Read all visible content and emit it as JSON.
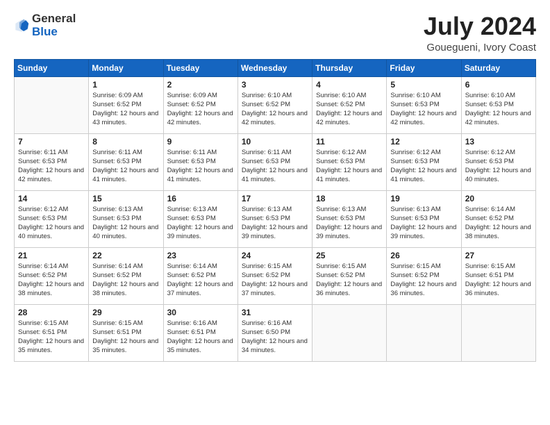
{
  "logo": {
    "text_general": "General",
    "text_blue": "Blue",
    "icon_title": "General Blue Logo"
  },
  "header": {
    "month": "July 2024",
    "location": "Gouegueni, Ivory Coast"
  },
  "weekdays": [
    "Sunday",
    "Monday",
    "Tuesday",
    "Wednesday",
    "Thursday",
    "Friday",
    "Saturday"
  ],
  "weeks": [
    [
      {
        "day": "",
        "sunrise": "",
        "sunset": "",
        "daylight": ""
      },
      {
        "day": "1",
        "sunrise": "Sunrise: 6:09 AM",
        "sunset": "Sunset: 6:52 PM",
        "daylight": "Daylight: 12 hours and 43 minutes."
      },
      {
        "day": "2",
        "sunrise": "Sunrise: 6:09 AM",
        "sunset": "Sunset: 6:52 PM",
        "daylight": "Daylight: 12 hours and 42 minutes."
      },
      {
        "day": "3",
        "sunrise": "Sunrise: 6:10 AM",
        "sunset": "Sunset: 6:52 PM",
        "daylight": "Daylight: 12 hours and 42 minutes."
      },
      {
        "day": "4",
        "sunrise": "Sunrise: 6:10 AM",
        "sunset": "Sunset: 6:52 PM",
        "daylight": "Daylight: 12 hours and 42 minutes."
      },
      {
        "day": "5",
        "sunrise": "Sunrise: 6:10 AM",
        "sunset": "Sunset: 6:53 PM",
        "daylight": "Daylight: 12 hours and 42 minutes."
      },
      {
        "day": "6",
        "sunrise": "Sunrise: 6:10 AM",
        "sunset": "Sunset: 6:53 PM",
        "daylight": "Daylight: 12 hours and 42 minutes."
      }
    ],
    [
      {
        "day": "7",
        "sunrise": "Sunrise: 6:11 AM",
        "sunset": "Sunset: 6:53 PM",
        "daylight": "Daylight: 12 hours and 42 minutes."
      },
      {
        "day": "8",
        "sunrise": "Sunrise: 6:11 AM",
        "sunset": "Sunset: 6:53 PM",
        "daylight": "Daylight: 12 hours and 41 minutes."
      },
      {
        "day": "9",
        "sunrise": "Sunrise: 6:11 AM",
        "sunset": "Sunset: 6:53 PM",
        "daylight": "Daylight: 12 hours and 41 minutes."
      },
      {
        "day": "10",
        "sunrise": "Sunrise: 6:11 AM",
        "sunset": "Sunset: 6:53 PM",
        "daylight": "Daylight: 12 hours and 41 minutes."
      },
      {
        "day": "11",
        "sunrise": "Sunrise: 6:12 AM",
        "sunset": "Sunset: 6:53 PM",
        "daylight": "Daylight: 12 hours and 41 minutes."
      },
      {
        "day": "12",
        "sunrise": "Sunrise: 6:12 AM",
        "sunset": "Sunset: 6:53 PM",
        "daylight": "Daylight: 12 hours and 41 minutes."
      },
      {
        "day": "13",
        "sunrise": "Sunrise: 6:12 AM",
        "sunset": "Sunset: 6:53 PM",
        "daylight": "Daylight: 12 hours and 40 minutes."
      }
    ],
    [
      {
        "day": "14",
        "sunrise": "Sunrise: 6:12 AM",
        "sunset": "Sunset: 6:53 PM",
        "daylight": "Daylight: 12 hours and 40 minutes."
      },
      {
        "day": "15",
        "sunrise": "Sunrise: 6:13 AM",
        "sunset": "Sunset: 6:53 PM",
        "daylight": "Daylight: 12 hours and 40 minutes."
      },
      {
        "day": "16",
        "sunrise": "Sunrise: 6:13 AM",
        "sunset": "Sunset: 6:53 PM",
        "daylight": "Daylight: 12 hours and 39 minutes."
      },
      {
        "day": "17",
        "sunrise": "Sunrise: 6:13 AM",
        "sunset": "Sunset: 6:53 PM",
        "daylight": "Daylight: 12 hours and 39 minutes."
      },
      {
        "day": "18",
        "sunrise": "Sunrise: 6:13 AM",
        "sunset": "Sunset: 6:53 PM",
        "daylight": "Daylight: 12 hours and 39 minutes."
      },
      {
        "day": "19",
        "sunrise": "Sunrise: 6:13 AM",
        "sunset": "Sunset: 6:53 PM",
        "daylight": "Daylight: 12 hours and 39 minutes."
      },
      {
        "day": "20",
        "sunrise": "Sunrise: 6:14 AM",
        "sunset": "Sunset: 6:52 PM",
        "daylight": "Daylight: 12 hours and 38 minutes."
      }
    ],
    [
      {
        "day": "21",
        "sunrise": "Sunrise: 6:14 AM",
        "sunset": "Sunset: 6:52 PM",
        "daylight": "Daylight: 12 hours and 38 minutes."
      },
      {
        "day": "22",
        "sunrise": "Sunrise: 6:14 AM",
        "sunset": "Sunset: 6:52 PM",
        "daylight": "Daylight: 12 hours and 38 minutes."
      },
      {
        "day": "23",
        "sunrise": "Sunrise: 6:14 AM",
        "sunset": "Sunset: 6:52 PM",
        "daylight": "Daylight: 12 hours and 37 minutes."
      },
      {
        "day": "24",
        "sunrise": "Sunrise: 6:15 AM",
        "sunset": "Sunset: 6:52 PM",
        "daylight": "Daylight: 12 hours and 37 minutes."
      },
      {
        "day": "25",
        "sunrise": "Sunrise: 6:15 AM",
        "sunset": "Sunset: 6:52 PM",
        "daylight": "Daylight: 12 hours and 36 minutes."
      },
      {
        "day": "26",
        "sunrise": "Sunrise: 6:15 AM",
        "sunset": "Sunset: 6:52 PM",
        "daylight": "Daylight: 12 hours and 36 minutes."
      },
      {
        "day": "27",
        "sunrise": "Sunrise: 6:15 AM",
        "sunset": "Sunset: 6:51 PM",
        "daylight": "Daylight: 12 hours and 36 minutes."
      }
    ],
    [
      {
        "day": "28",
        "sunrise": "Sunrise: 6:15 AM",
        "sunset": "Sunset: 6:51 PM",
        "daylight": "Daylight: 12 hours and 35 minutes."
      },
      {
        "day": "29",
        "sunrise": "Sunrise: 6:15 AM",
        "sunset": "Sunset: 6:51 PM",
        "daylight": "Daylight: 12 hours and 35 minutes."
      },
      {
        "day": "30",
        "sunrise": "Sunrise: 6:16 AM",
        "sunset": "Sunset: 6:51 PM",
        "daylight": "Daylight: 12 hours and 35 minutes."
      },
      {
        "day": "31",
        "sunrise": "Sunrise: 6:16 AM",
        "sunset": "Sunset: 6:50 PM",
        "daylight": "Daylight: 12 hours and 34 minutes."
      },
      {
        "day": "",
        "sunrise": "",
        "sunset": "",
        "daylight": ""
      },
      {
        "day": "",
        "sunrise": "",
        "sunset": "",
        "daylight": ""
      },
      {
        "day": "",
        "sunrise": "",
        "sunset": "",
        "daylight": ""
      }
    ]
  ]
}
